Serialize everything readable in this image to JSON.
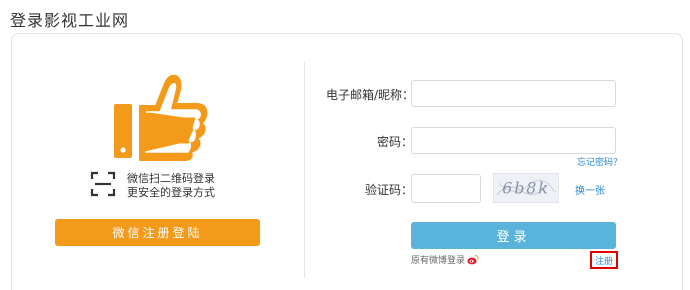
{
  "page": {
    "title": "登录影视工业网"
  },
  "qr": {
    "line1": "微信扫二维码登录",
    "line2": "更安全的登录方式"
  },
  "wechat": {
    "button_label": "微信注册登陆"
  },
  "form": {
    "email_label": "电子邮箱/昵称：",
    "email_value": "",
    "password_label": "密码：",
    "password_value": "",
    "forgot_label": "忘记密码？",
    "captcha_label": "验证码：",
    "captcha_value": "",
    "captcha_text": "6b8k",
    "refresh_label": "换一张",
    "login_label": "登录"
  },
  "footer": {
    "weibo_label": "原有微博登录",
    "register_label": "注册"
  },
  "colors": {
    "orange": "#f39a1b",
    "blue": "#5ab3db",
    "link": "#2a8ad6",
    "highlight": "#e00000"
  },
  "icons": {
    "thumb": "thumbs-up-icon",
    "qr": "qr-scan-icon",
    "weibo": "weibo-icon"
  }
}
